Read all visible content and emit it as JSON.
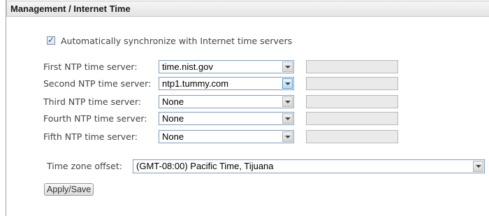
{
  "header": {
    "title": "Management / Internet Time"
  },
  "auto_sync": {
    "checked": true,
    "label": "Automatically synchronize with Internet time servers"
  },
  "ntp_servers": [
    {
      "label": "First NTP time server:",
      "value": "time.nist.gov"
    },
    {
      "label": "Second NTP time server:",
      "value": "ntp1.tummy.com"
    },
    {
      "label": "Third NTP time server:",
      "value": "None"
    },
    {
      "label": "Fourth NTP time server:",
      "value": "None"
    },
    {
      "label": "Fifth NTP time server:",
      "value": "None"
    }
  ],
  "timezone": {
    "label": "Time zone offset:",
    "value": "(GMT-08:00) Pacific Time, Tijuana"
  },
  "apply_button": {
    "label": "Apply/Save"
  },
  "icons": {
    "checkbox_mark": "✓",
    "dropdown": "chevron-down-icon"
  }
}
